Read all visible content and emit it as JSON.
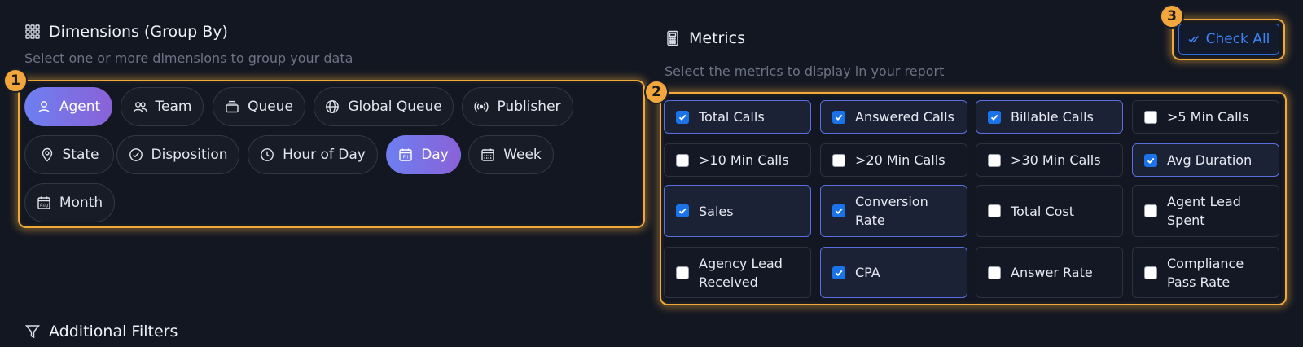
{
  "dimensions": {
    "title": "Dimensions (Group By)",
    "subtitle": "Select one or more dimensions to group your data",
    "badge": "1",
    "items": [
      {
        "label": "Agent",
        "icon": "user-icon",
        "active": true
      },
      {
        "label": "Team",
        "icon": "users-icon",
        "active": false
      },
      {
        "label": "Queue",
        "icon": "queue-icon",
        "active": false
      },
      {
        "label": "Global Queue",
        "icon": "globe-icon",
        "active": false
      },
      {
        "label": "Publisher",
        "icon": "broadcast-icon",
        "active": false
      },
      {
        "label": "State",
        "icon": "map-pin-icon",
        "active": false
      },
      {
        "label": "Disposition",
        "icon": "check-circle-icon",
        "active": false
      },
      {
        "label": "Hour of Day",
        "icon": "clock-icon",
        "active": false
      },
      {
        "label": "Day",
        "icon": "calendar-day-icon",
        "active": true
      },
      {
        "label": "Week",
        "icon": "calendar-week-icon",
        "active": false
      },
      {
        "label": "Month",
        "icon": "calendar-month-icon",
        "active": false
      }
    ]
  },
  "metrics": {
    "title": "Metrics",
    "subtitle": "Select the metrics to display in your report",
    "badge": "2",
    "check_all_badge": "3",
    "check_all_label": "Check All",
    "items": [
      {
        "label": "Total Calls",
        "checked": true
      },
      {
        "label": "Answered Calls",
        "checked": true
      },
      {
        "label": "Billable Calls",
        "checked": true
      },
      {
        "label": ">5 Min Calls",
        "checked": false
      },
      {
        "label": ">10 Min Calls",
        "checked": false
      },
      {
        "label": ">20 Min Calls",
        "checked": false
      },
      {
        "label": ">30 Min Calls",
        "checked": false
      },
      {
        "label": "Avg Duration",
        "checked": true
      },
      {
        "label": "Sales",
        "checked": true
      },
      {
        "label": "Conversion Rate",
        "checked": true
      },
      {
        "label": "Total Cost",
        "checked": false
      },
      {
        "label": "Agent Lead Spent",
        "checked": false
      },
      {
        "label": "Agency Lead Received",
        "checked": false
      },
      {
        "label": "CPA",
        "checked": true
      },
      {
        "label": "Answer Rate",
        "checked": false
      },
      {
        "label": "Compliance Pass Rate",
        "checked": false
      }
    ]
  },
  "filters": {
    "title": "Additional Filters"
  },
  "colors": {
    "background": "#121722",
    "highlight": "#f0a83a",
    "active_gradient_start": "#6d7ff0",
    "active_gradient_end": "#8a62d8",
    "checkbox_checked": "#1a73e8",
    "check_all_text": "#3d86f5"
  }
}
